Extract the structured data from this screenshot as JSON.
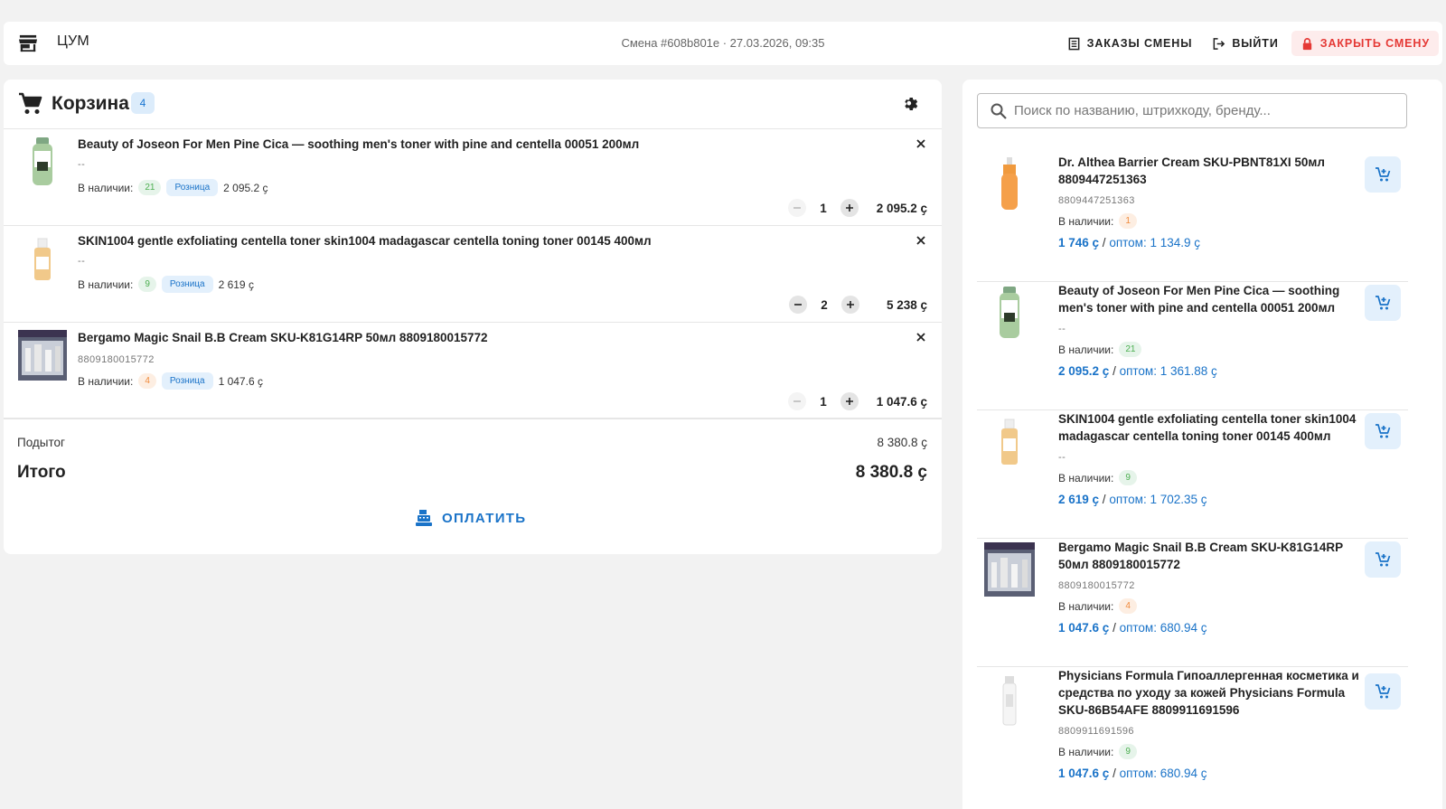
{
  "header": {
    "store_icon": "store-icon",
    "store_name": "ЦУМ",
    "shift_info": "Смена #608b801e · 27.03.2026, 09:35",
    "orders_label": "ЗАКАЗЫ СМЕНЫ",
    "logout_label": "ВЫЙТИ",
    "close_shift_label": "ЗАКРЫТЬ СМЕНУ"
  },
  "cart": {
    "title": "Корзина",
    "count": "4",
    "items": [
      {
        "name": "Beauty of Joseon For Men Pine Cica — soothing men's toner with pine and centella 00051 200мл",
        "sub": "--",
        "stock_label": "В наличии:",
        "stock": "21",
        "stock_color": "green",
        "price_type": "Розница",
        "unit_price": "2 095.2 ҫ",
        "qty": "1",
        "line_total": "2 095.2 ҫ"
      },
      {
        "name": "SKIN1004 gentle exfoliating centella toner skin1004 madagascar centella toning toner 00145 400мл",
        "sub": "--",
        "stock_label": "В наличии:",
        "stock": "9",
        "stock_color": "green",
        "price_type": "Розница",
        "unit_price": "2 619 ҫ",
        "qty": "2",
        "line_total": "5 238 ҫ"
      },
      {
        "name": "Bergamo Magic Snail B.B Cream SKU-K81G14RP 50мл 8809180015772",
        "sub": "8809180015772",
        "stock_label": "В наличии:",
        "stock": "4",
        "stock_color": "orange",
        "price_type": "Розница",
        "unit_price": "1 047.6 ҫ",
        "qty": "1",
        "line_total": "1 047.6 ҫ"
      }
    ],
    "subtotal_label": "Подытог",
    "subtotal": "8 380.8 ҫ",
    "total_label": "Итого",
    "total": "8 380.8 ҫ",
    "pay_label": "ОПЛАТИТЬ"
  },
  "search": {
    "placeholder": "Поиск по названию, штрихкоду, бренду...",
    "value": ""
  },
  "products": [
    {
      "name": "Dr. Althea Barrier Cream SKU-PBNT81XI 50мл 8809447251363",
      "sub": "8809447251363",
      "stock_label": "В наличии:",
      "stock": "1",
      "stock_color": "orange",
      "price": "1 746 ҫ",
      "sep": " / ",
      "wholesale": "оптом: 1 134.9 ҫ"
    },
    {
      "name": "Beauty of Joseon For Men Pine Cica — soothing men's toner with pine and centella 00051 200мл",
      "sub": "--",
      "stock_label": "В наличии:",
      "stock": "21",
      "stock_color": "green",
      "price": "2 095.2 ҫ",
      "sep": " / ",
      "wholesale": "оптом: 1 361.88 ҫ"
    },
    {
      "name": "SKIN1004 gentle exfoliating centella toner skin1004 madagascar centella toning toner 00145 400мл",
      "sub": "--",
      "stock_label": "В наличии:",
      "stock": "9",
      "stock_color": "green",
      "price": "2 619 ҫ",
      "sep": " / ",
      "wholesale": "оптом: 1 702.35 ҫ"
    },
    {
      "name": "Bergamo Magic Snail B.B Cream SKU-K81G14RP 50мл 8809180015772",
      "sub": "8809180015772",
      "stock_label": "В наличии:",
      "stock": "4",
      "stock_color": "orange",
      "price": "1 047.6 ҫ",
      "sep": " / ",
      "wholesale": "оптом: 680.94 ҫ"
    },
    {
      "name": "Physicians Formula Гипоаллергенная косметика и средства по уходу за кожей Physicians Formula SKU-86B54AFE 8809911691596",
      "sub": "8809911691596",
      "stock_label": "В наличии:",
      "stock": "9",
      "stock_color": "green",
      "price": "1 047.6 ҫ",
      "sep": " / ",
      "wholesale": "оптом: 680.94 ҫ"
    }
  ],
  "colors": {
    "accent": "#1a73c8",
    "danger": "#e53935",
    "background": "#f2f2f2"
  }
}
